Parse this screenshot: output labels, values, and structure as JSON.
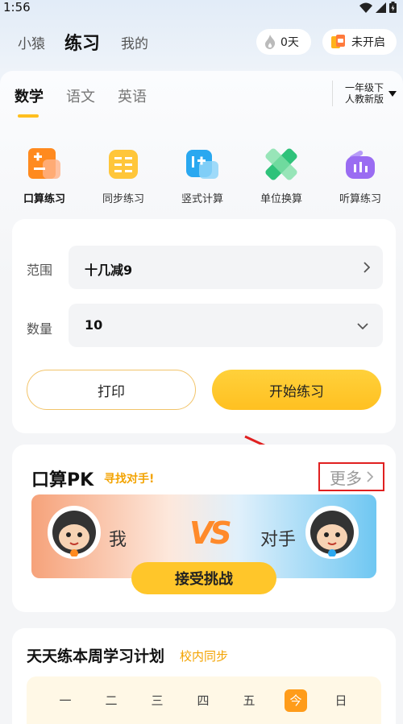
{
  "status_bar": {
    "time": "1:56"
  },
  "top_nav": {
    "tabs": [
      "小猿",
      "练习",
      "我的"
    ],
    "streak_label": "0天",
    "challenge_label": "未开启"
  },
  "subjects": {
    "tabs": [
      "数学",
      "语文",
      "英语"
    ],
    "grade_line1": "一年级下",
    "grade_line2": "人教新版"
  },
  "categories": [
    {
      "label": "口算练习",
      "icon": "calc-icon"
    },
    {
      "label": "同步练习",
      "icon": "book-icon"
    },
    {
      "label": "竖式计算",
      "icon": "vertical-calc-icon"
    },
    {
      "label": "单位换算",
      "icon": "ruler-icon"
    },
    {
      "label": "听算练习",
      "icon": "audio-icon"
    }
  ],
  "practice": {
    "range_label": "范围",
    "range_value": "十几减9",
    "count_label": "数量",
    "count_value": "10",
    "print_label": "打印",
    "start_label": "开始练习"
  },
  "pk": {
    "title": "口算PK",
    "subtitle": "寻找对手!",
    "more_label": "更多",
    "me_label": "我",
    "opponent_label": "对手",
    "vs": "VS",
    "accept_label": "接受挑战"
  },
  "plan": {
    "title": "天天练本周学习计划",
    "subtitle": "校内同步",
    "days": [
      "一",
      "二",
      "三",
      "四",
      "五",
      "今",
      "日"
    ]
  },
  "colors": {
    "accent": "#ffc62a",
    "highlight": "#f3a300",
    "annotation": "#e02020"
  }
}
